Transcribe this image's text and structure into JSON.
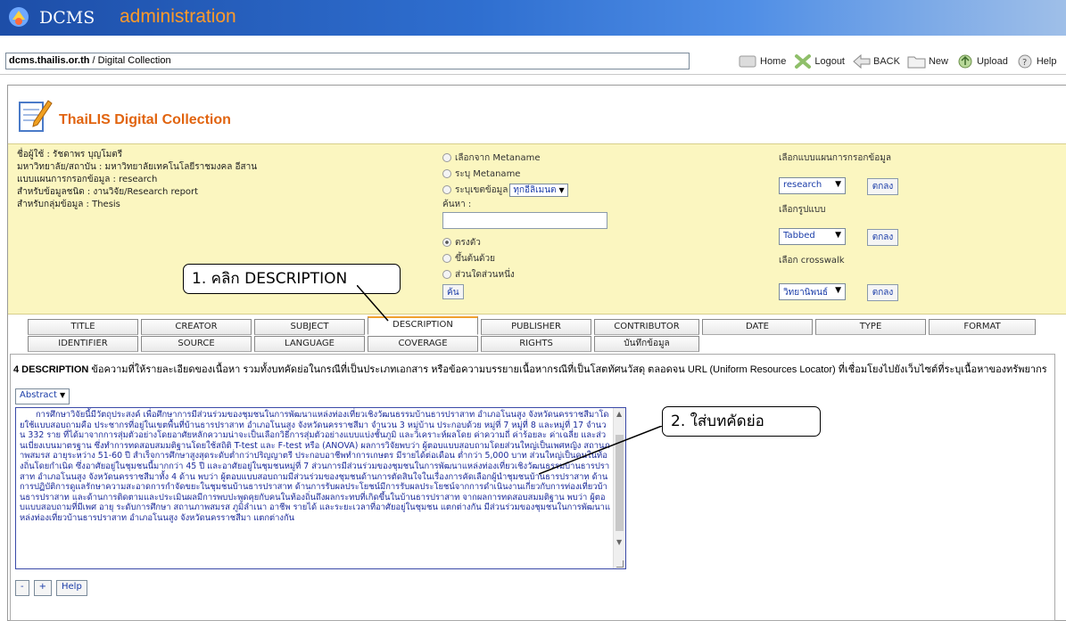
{
  "banner": {
    "app_name": "DCMS",
    "app_sub": "administration"
  },
  "address": {
    "host": "dcms.thailis.or.th",
    "path": " / Digital Collection"
  },
  "toolbar": {
    "home": "Home",
    "logout": "Logout",
    "back": "BACK",
    "new": "New",
    "upload": "Upload",
    "help": "Help"
  },
  "brand": {
    "title": "ThaiLIS Digital Collection"
  },
  "user_info": [
    "ชื่อผู้ใช้ : รัชดาพร บุญโมตรี",
    "มหาวิทยาลัย/สถาบัน : มหาวิทยาลัยเทคโนโลยีราชมงคล อีสาน",
    "แบบแผนการกรอกข้อมูล : research",
    "สำหรับข้อมูลชนิด : งานวิจัย/Research report",
    "สำหรับกลุ่มข้อมูล : Thesis"
  ],
  "search": {
    "opt_from_metaname": "เลือกจาก Metaname",
    "opt_specify_metaname": "ระบุ Metaname",
    "opt_scope": "ระบุเขตข้อมูล",
    "scope_select": "ทุกอีลิเมนต",
    "search_label": "ค้นหา :",
    "match_exact": "ตรงตัว",
    "match_begins": "ขึ้นต้นด้วย",
    "match_any": "ส่วนใดส่วนหนึ่ง",
    "search_button": "ค้น"
  },
  "config": {
    "template_label": "เลือกแบบแผนการกรอกข้อมูล",
    "template_value": "research",
    "format_label": "เลือกรูปแบบ",
    "format_value": "Tabbed",
    "crosswalk_label": "เลือก crosswalk",
    "crosswalk_value": "วิทยานิพนธ์",
    "ok": "ตกลง"
  },
  "callouts": {
    "step1": "1. คลิก DESCRIPTION",
    "step2": "2. ใส่บทคัดย่อ"
  },
  "tabs_row1": [
    "TITLE",
    "CREATOR",
    "SUBJECT",
    "DESCRIPTION",
    "PUBLISHER",
    "CONTRIBUTOR",
    "DATE",
    "TYPE",
    "FORMAT"
  ],
  "tabs_row2": [
    "IDENTIFIER",
    "SOURCE",
    "LANGUAGE",
    "COVERAGE",
    "RIGHTS",
    "บันทึกข้อมูล"
  ],
  "active_tab": "DESCRIPTION",
  "field": {
    "number_title": "4 DESCRIPTION",
    "description": " ข้อความที่ให้รายละเอียดของเนื้อหา รวมทั้งบทคัดย่อในกรณีที่เป็นประเภทเอกสาร หรือข้อความบรรยายเนื้อหากรณีที่เป็นโสตทัศนวัสดุ ตลอดจน URL (Uniform Resources Locator) ที่เชื่อมโยงไปยังเว็บไซต์ที่ระบุเนื้อหาของทรัพยากร",
    "qualifier": "Abstract",
    "abstract_text": "การศึกษาวิจัยนี้มีวัตถุประสงค์ เพื่อศึกษาการมีส่วนร่วมของชุมชนในการพัฒนาแหล่งท่องเที่ยวเชิงวัฒนธรรมบ้านธารปราสาท อำเภอโนนสูง จังหวัดนครราชสีมาโดยใช้แบบสอบถามคือ ประชากรที่อยู่ในเขตพื้นที่บ้านธารปราสาท อำเภอโนนสูง จังหวัดนครราชสีมา จำนวน 3 หมู่บ้าน ประกอบด้วย หมู่ที่ 7 หมู่ที่ 8 และหมู่ที่ 17 จำนวน 332 ราย ที่ได้มาจากการสุ่มตัวอย่างโดยอาศัยหลักความน่าจะเป็นเลือกวิธีการสุ่มตัวอย่างแบบแบ่งชั้นภูมิ และวิเคราะห์ผลโดย ค่าความถี่ ค่าร้อยละ ค่าเฉลี่ย และส่วนเบี่ยงเบนมาตรฐาน ซึ่งทำการทดสอบสมมติฐานโดยใช้สถิติ T-test และ F-test หรือ (ANOVA) ผลการวิจัยพบว่า ผู้ตอบแบบสอบถามโดยส่วนใหญ่เป็นเพศหญิง สถานภาพสมรส อายุระหว่าง 51-60 ปี สำเร็จการศึกษาสูงสุดระดับต่ำกว่าปริญญาตรี ประกอบอาชีพทำการเกษตร มีรายได้ต่อเดือน ต่ำกว่า 5,000 บาท ส่วนใหญ่เป็นคนในท้องถิ่นโดยกำเนิด ซึ่งอาศัยอยู่ในชุมชนนี้มากกว่า 45 ปี และอาศัยอยู่ในชุมชนหมู่ที่ 7 ส่วนการมีส่วนร่วมของชุมชนในการพัฒนาแหล่งท่องเที่ยวเชิงวัฒนธรรมบ้านธารปราสาท อำเภอโนนสูง จังหวัดนครราชสีมาทั้ง 4 ด้าน พบว่า ผู้ตอบแบบสอบถามมีส่วนร่วมของชุมชนด้านการตัดสินใจในเรื่องการคัดเลือกผู้นำชุมชนบ้านธารปราสาท ด้านการปฏิบัติการดูแลรักษาความสะอาดการกำจัดขยะในชุมชนบ้านธารปราสาท ด้านการรับผลประโยชน์มีการรับผลประโยชน์จากการดำเนินงานเกี่ยวกับการท่องเที่ยวบ้านธารปราสาท และด้านการติดตามและประเมินผลมีการพบปะพูดคุยกับคนในท้องถิ่นถึงผลกระทบที่เกิดขึ้นในบ้านธารปราสาท จากผลการทดสอบสมมติฐาน พบว่า ผู้ตอบแบบสอบถามที่มีเพศ อายุ ระดับการศึกษา สถานภาพสมรส ภูมิลำเนา อาชีพ รายได้ และระยะเวลาที่อาศัยอยู่ในชุมชน แตกต่างกัน มีส่วนร่วมของชุมชนในการพัฒนาแหล่งท่องเที่ยวบ้านธารปราสาท อำเภอโนนสูง จังหวัดนครราชสีมา แตกต่างกัน",
    "btn_minus": "-",
    "btn_plus": "+",
    "btn_help": "Help"
  }
}
